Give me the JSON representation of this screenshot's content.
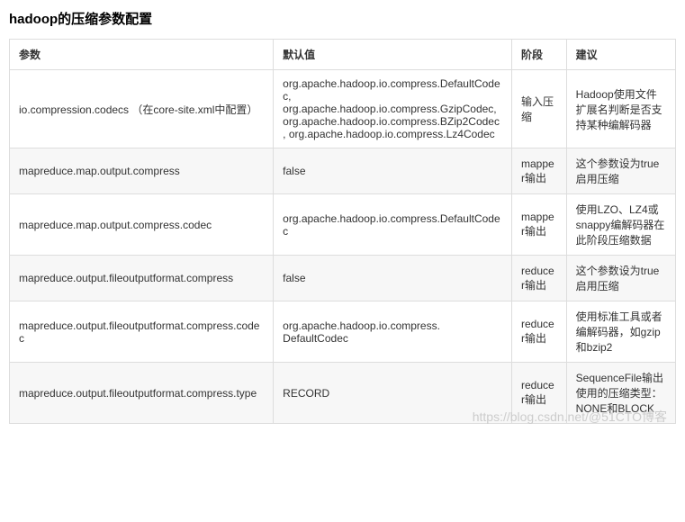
{
  "title": "hadoop的压缩参数配置",
  "headers": {
    "param": "参数",
    "default": "默认值",
    "stage": "阶段",
    "suggest": "建议"
  },
  "rows": [
    {
      "param": "io.compression.codecs （在core-site.xml中配置）",
      "default": "org.apache.hadoop.io.compress.DefaultCodec, org.apache.hadoop.io.compress.GzipCodec, org.apache.hadoop.io.compress.BZip2Codec, org.apache.hadoop.io.compress.Lz4Codec",
      "stage": "输入压缩",
      "suggest": "Hadoop使用文件扩展名判断是否支持某种编解码器"
    },
    {
      "param": "mapreduce.map.output.compress",
      "default": "false",
      "stage": "mapper输出",
      "suggest": "这个参数设为true启用压缩"
    },
    {
      "param": "mapreduce.map.output.compress.codec",
      "default": "org.apache.hadoop.io.compress.DefaultCodec",
      "stage": "mapper输出",
      "suggest": "使用LZO、LZ4或snappy编解码器在此阶段压缩数据"
    },
    {
      "param": "mapreduce.output.fileoutputformat.compress",
      "default": "false",
      "stage": "reducer输出",
      "suggest": "这个参数设为true启用压缩"
    },
    {
      "param": "mapreduce.output.fileoutputformat.compress.codec",
      "default": "org.apache.hadoop.io.compress. DefaultCodec",
      "stage": "reducer输出",
      "suggest": "使用标准工具或者编解码器，如gzip和bzip2"
    },
    {
      "param": "mapreduce.output.fileoutputformat.compress.type",
      "default": "RECORD",
      "stage": "reducer输出",
      "suggest": "SequenceFile输出使用的压缩类型：NONE和BLOCK"
    }
  ],
  "watermark": "https://blog.csdn.net/@51CTO博客"
}
